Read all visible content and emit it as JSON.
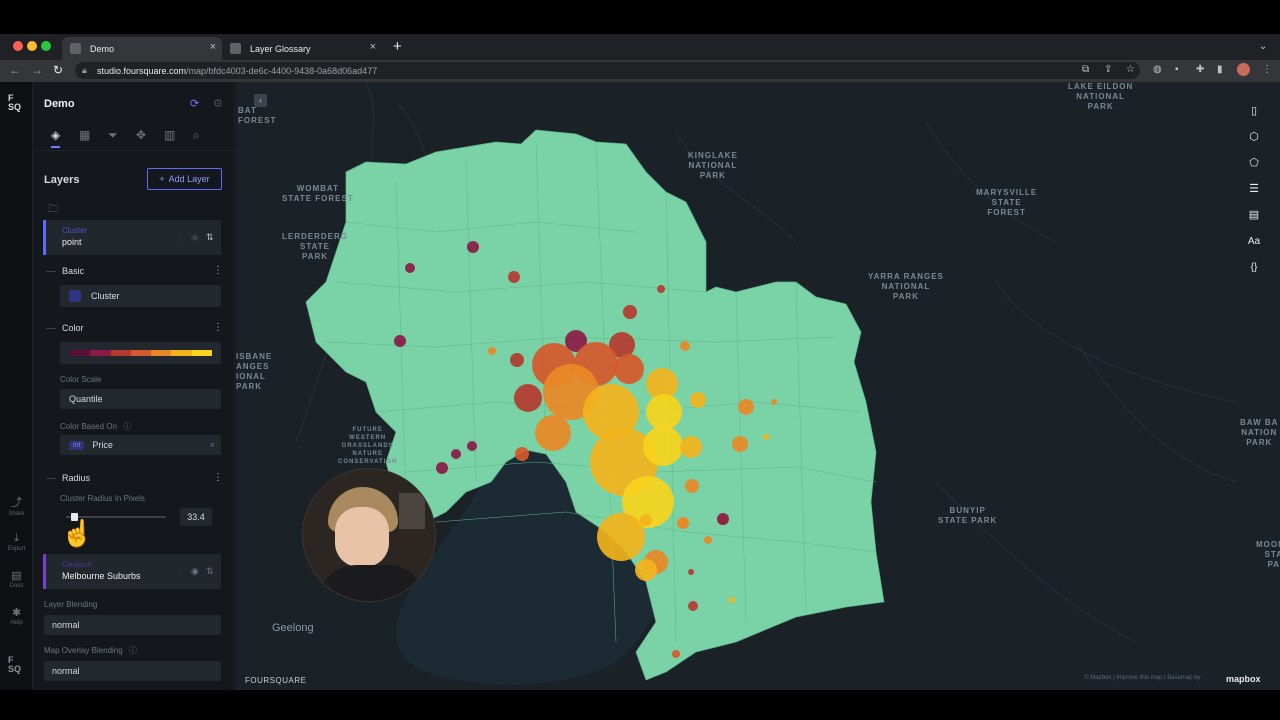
{
  "browser": {
    "tabs": [
      {
        "label": "Demo",
        "active": true
      },
      {
        "label": "Layer Glossary",
        "active": false
      }
    ],
    "url_host": "studio.foursquare.com",
    "url_path": "/map/bfdc4003-de6c-4400-9438-0a68d06ad477"
  },
  "rail": {
    "logo": "F\nSQ",
    "items": [
      {
        "icon": "share-icon",
        "label": "Share"
      },
      {
        "icon": "export-icon",
        "label": "Export"
      },
      {
        "icon": "docs-icon",
        "label": "Docs"
      },
      {
        "icon": "help-icon",
        "label": "Help"
      }
    ],
    "footer_logo": "F\nSQ"
  },
  "panel": {
    "title": "Demo",
    "section_title": "Layers",
    "add_layer_label": "Add Layer",
    "layer_cluster": {
      "type": "Cluster",
      "name": "point"
    },
    "basic": {
      "title": "Basic",
      "layer_type": "Cluster"
    },
    "color": {
      "title": "Color",
      "palette": [
        "#5a0f3c",
        "#8b1a47",
        "#b53a2e",
        "#d7582a",
        "#e98826",
        "#f2b31b",
        "#f8d41c"
      ],
      "scale_label": "Color Scale",
      "scale_value": "Quantile",
      "based_on_label": "Color Based On",
      "based_on_type": "int",
      "based_on_value": "Price"
    },
    "radius": {
      "title": "Radius",
      "label": "Cluster Radius In Pixels",
      "value": "33.4",
      "slider_fraction": 0.05
    },
    "layer_geojson": {
      "type": "Geojson",
      "name": "Melbourne Suburbs"
    },
    "layer_blending": {
      "label": "Layer Blending",
      "value": "normal"
    },
    "overlay_blending": {
      "label": "Map Overlay Blending",
      "value": "normal"
    }
  },
  "map": {
    "labels": [
      {
        "text": "WOMBAT\nSTATE FOREST",
        "key": "wombat"
      },
      {
        "text": "LERDERDERG\nSTATE\nPARK",
        "key": "lerderderg"
      },
      {
        "text": "KINGLAKE\nNATIONAL\nPARK",
        "key": "kinglake"
      },
      {
        "text": "LAKE EILDON\nNATIONAL\nPARK",
        "key": "eildon"
      },
      {
        "text": "MARYSVILLE\nSTATE\nFOREST",
        "key": "marysville"
      },
      {
        "text": "YARRA RANGES\nNATIONAL\nPARK",
        "key": "yarra"
      },
      {
        "text": "BUNYIP\nSTATE PARK",
        "key": "bunyip"
      },
      {
        "text": "FUTURE\nWESTERN\nGRASSLANDS\nNATURE\nCONSERVATION",
        "key": "grasslands"
      },
      {
        "text": "ISBANE\nANGES\nIONAL\nPARK",
        "key": "brisbane"
      },
      {
        "text": "BAT\nFOREST",
        "key": "bat"
      },
      {
        "text": "BAW BA\nNATION\nPARK",
        "key": "bawbaw"
      },
      {
        "text": "MOOND\nSTA\nPA",
        "key": "moond"
      },
      {
        "text": "Geelong",
        "key": "geelong"
      }
    ],
    "brand": "FOURSQUARE",
    "attribution": "© Mapbox | Improve this map | Basemap by",
    "mapbox": "mapbox",
    "region_color": "#79d3a6",
    "tools": [
      "split-map-icon",
      "3d-cube-icon",
      "draw-polygon-icon",
      "legend-icon",
      "bar-chart-icon",
      "text-aa-icon",
      "code-braces-icon"
    ],
    "tool_glyphs": [
      "▯",
      "⬡",
      "⬠",
      "☰",
      "▤",
      "Aa",
      "{}"
    ]
  }
}
